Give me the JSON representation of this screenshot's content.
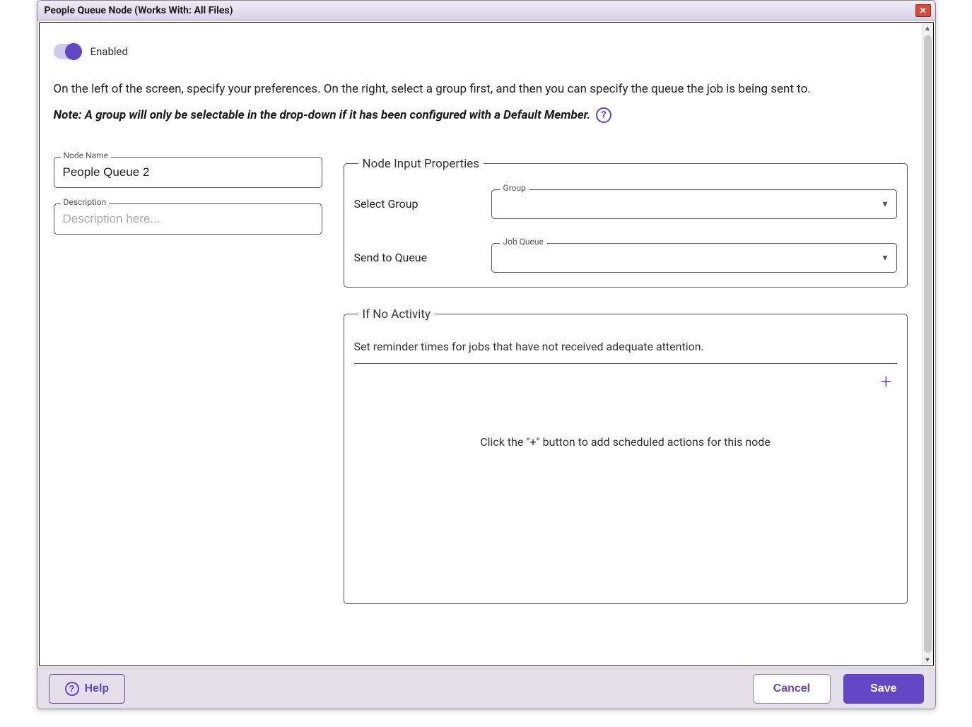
{
  "window": {
    "title": "People Queue Node (Works With: All Files)"
  },
  "toggle": {
    "label": "Enabled",
    "state": true
  },
  "intro": "On the left of the screen, specify your preferences. On the right, select a group first, and then you can specify the queue the job is being sent to.",
  "note": "Note: A group will only be selectable in the drop-down if it has been configured with a Default Member.",
  "fields": {
    "node_name": {
      "label": "Node Name",
      "value": "People Queue 2"
    },
    "description": {
      "label": "Description",
      "placeholder": "Description here..."
    }
  },
  "node_input": {
    "legend": "Node Input Properties",
    "select_group_label": "Select Group",
    "group_field_label": "Group",
    "send_queue_label": "Send to Queue",
    "job_queue_field_label": "Job Queue"
  },
  "no_activity": {
    "legend": "If No Activity",
    "description": "Set reminder times for jobs that have not received adequate attention.",
    "empty_message": "Click the \"+\" button to add scheduled actions for this node"
  },
  "footer": {
    "help": "Help",
    "cancel": "Cancel",
    "save": "Save"
  }
}
